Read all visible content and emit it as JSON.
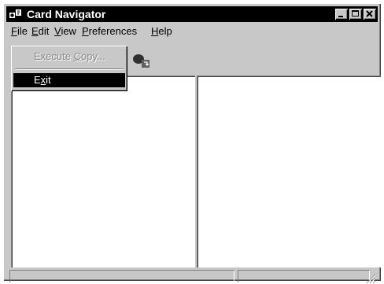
{
  "window": {
    "title": "Card Navigator",
    "app_icon": "card-navigator-app-icon",
    "controls": [
      {
        "name": "minimize",
        "icon": "minimize-icon"
      },
      {
        "name": "maximize",
        "icon": "maximize-icon"
      },
      {
        "name": "close",
        "icon": "close-icon"
      }
    ]
  },
  "menubar": {
    "items": [
      {
        "label": "File",
        "accel": "F",
        "rest": "ile"
      },
      {
        "label": "Edit",
        "accel": "E",
        "rest": "dit"
      },
      {
        "label": "View",
        "accel": "V",
        "rest": "iew"
      },
      {
        "label": "Preferences",
        "accel": "P",
        "rest": "references"
      },
      {
        "label": "Help",
        "accel": "H",
        "rest": "elp"
      }
    ]
  },
  "toolbar": {
    "buttons": [
      {
        "icon": "copy-card-icon",
        "enabled": true
      }
    ]
  },
  "file_menu": {
    "open": true,
    "items": [
      {
        "label": "Execute Copy...",
        "pre": "Execute ",
        "accel": "C",
        "post": "opy...",
        "enabled": false
      },
      {
        "separator": true
      },
      {
        "label": "Exit",
        "pre": "E",
        "accel": "x",
        "post": "it",
        "enabled": true,
        "highlighted": true
      }
    ]
  },
  "panes": {
    "left": {
      "content": ""
    },
    "right": {
      "content": ""
    }
  },
  "statusbar": {
    "panels": [
      "",
      ""
    ]
  },
  "colors": {
    "face": "#c8c8c8",
    "title_active": "#000000",
    "highlight": "#000000",
    "disabled_text": "#8a8a8a"
  }
}
